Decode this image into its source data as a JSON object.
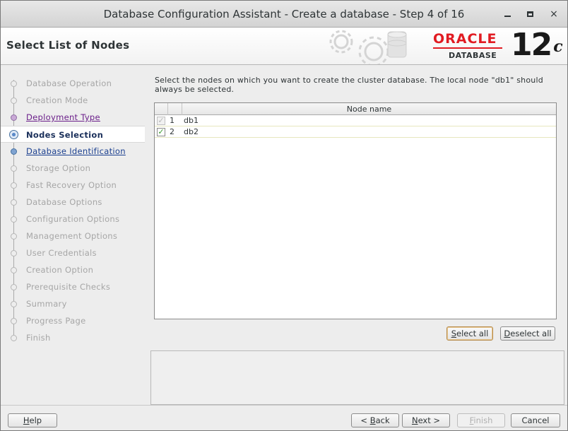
{
  "window": {
    "title": "Database Configuration Assistant - Create a database - Step 4 of 16",
    "controls": {
      "minimize": "minimize",
      "maximize": "maximize",
      "close": "×"
    }
  },
  "header": {
    "page_title": "Select List of Nodes",
    "brand": {
      "oracle": "ORACLE",
      "database": "DATABASE",
      "version": "12",
      "version_suffix": "c"
    }
  },
  "steps": [
    {
      "label": "Database Operation",
      "state": "done"
    },
    {
      "label": "Creation Mode",
      "state": "done"
    },
    {
      "label": "Deployment Type",
      "state": "visited"
    },
    {
      "label": "Nodes Selection",
      "state": "current"
    },
    {
      "label": "Database Identification",
      "state": "link"
    },
    {
      "label": "Storage Option",
      "state": "pending"
    },
    {
      "label": "Fast Recovery Option",
      "state": "pending"
    },
    {
      "label": "Database Options",
      "state": "pending"
    },
    {
      "label": "Configuration Options",
      "state": "pending"
    },
    {
      "label": "Management Options",
      "state": "pending"
    },
    {
      "label": "User Credentials",
      "state": "pending"
    },
    {
      "label": "Creation Option",
      "state": "pending"
    },
    {
      "label": "Prerequisite Checks",
      "state": "pending"
    },
    {
      "label": "Summary",
      "state": "pending"
    },
    {
      "label": "Progress Page",
      "state": "pending"
    },
    {
      "label": "Finish",
      "state": "pending"
    }
  ],
  "main": {
    "instructions": "Select the nodes on which you want to create the cluster database. The local node \"db1\" should always be selected.",
    "table": {
      "column_header": "Node name",
      "rows": [
        {
          "num": "1",
          "name": "db1",
          "checked": true,
          "disabled": true
        },
        {
          "num": "2",
          "name": "db2",
          "checked": true,
          "disabled": false
        }
      ]
    },
    "select_all": {
      "mnemonic": "S",
      "rest": "elect all"
    },
    "deselect_all": {
      "mnemonic": "D",
      "rest": "eselect all"
    }
  },
  "footer": {
    "help": {
      "mnemonic": "H",
      "rest": "elp"
    },
    "back": {
      "prefix": "< ",
      "mnemonic": "B",
      "rest": "ack"
    },
    "next": {
      "mnemonic": "N",
      "rest": "ext >"
    },
    "finish": {
      "mnemonic": "F",
      "rest": "inish"
    },
    "cancel": "Cancel"
  },
  "colors": {
    "oracle_red": "#e11b22",
    "visited_link": "#6b1f8a",
    "link": "#1a3f8f",
    "check_green": "#3a9a2e"
  }
}
